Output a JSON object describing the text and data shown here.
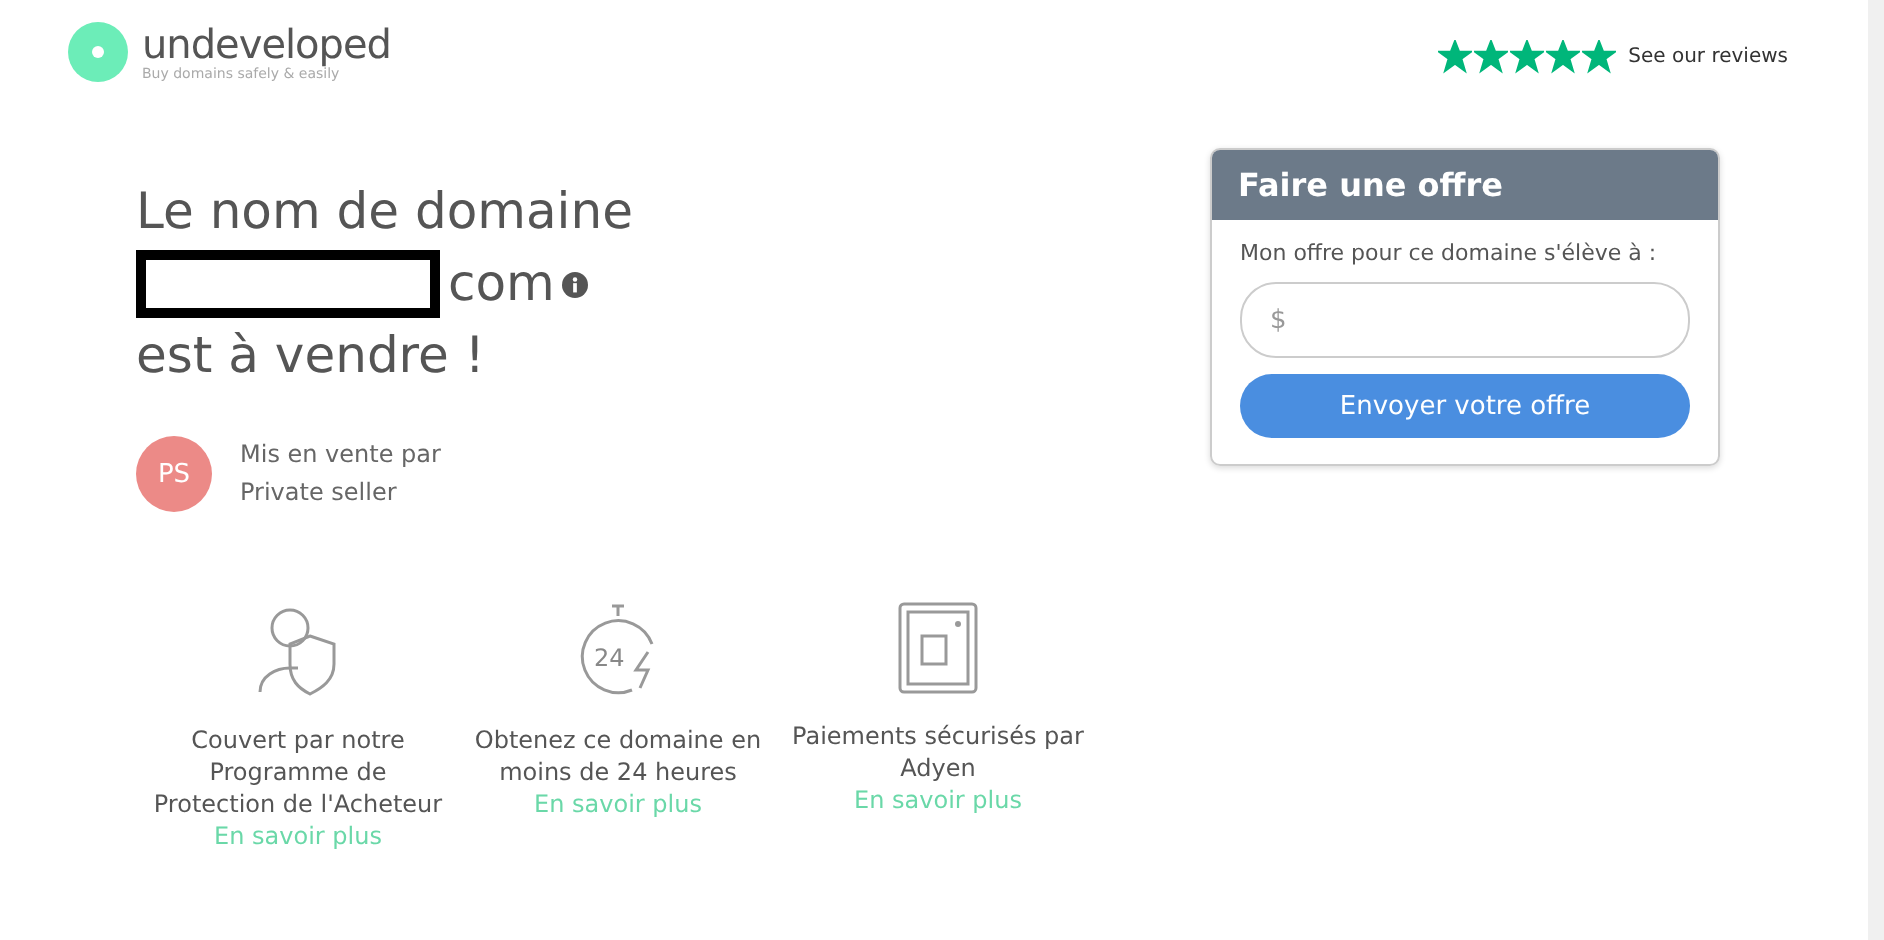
{
  "header": {
    "logo": {
      "name": "undeveloped",
      "tagline": "Buy domains safely & easily"
    },
    "reviews": {
      "stars": 5,
      "label": "See our reviews"
    }
  },
  "hero": {
    "line_1": "Le nom de domaine",
    "domain_suffix": "com",
    "line_3": "est à vendre !"
  },
  "seller": {
    "initials": "PS",
    "line_1": "Mis en vente par",
    "line_2": "Private seller"
  },
  "offer": {
    "title": "Faire une offre",
    "label": "Mon offre pour ce domaine s'élève à :",
    "placeholder": "$",
    "button": "Envoyer votre offre"
  },
  "features": [
    {
      "kind": "protection",
      "text": "Couvert par notre Programme de Protection de l'Acheteur",
      "link": "En savoir plus"
    },
    {
      "kind": "timer",
      "icon_text": "24",
      "text": "Obtenez ce domaine en moins de 24 heures",
      "link": "En savoir plus"
    },
    {
      "kind": "safe",
      "text": "Paiements sécurisés par Adyen",
      "link": "En savoir plus"
    }
  ]
}
